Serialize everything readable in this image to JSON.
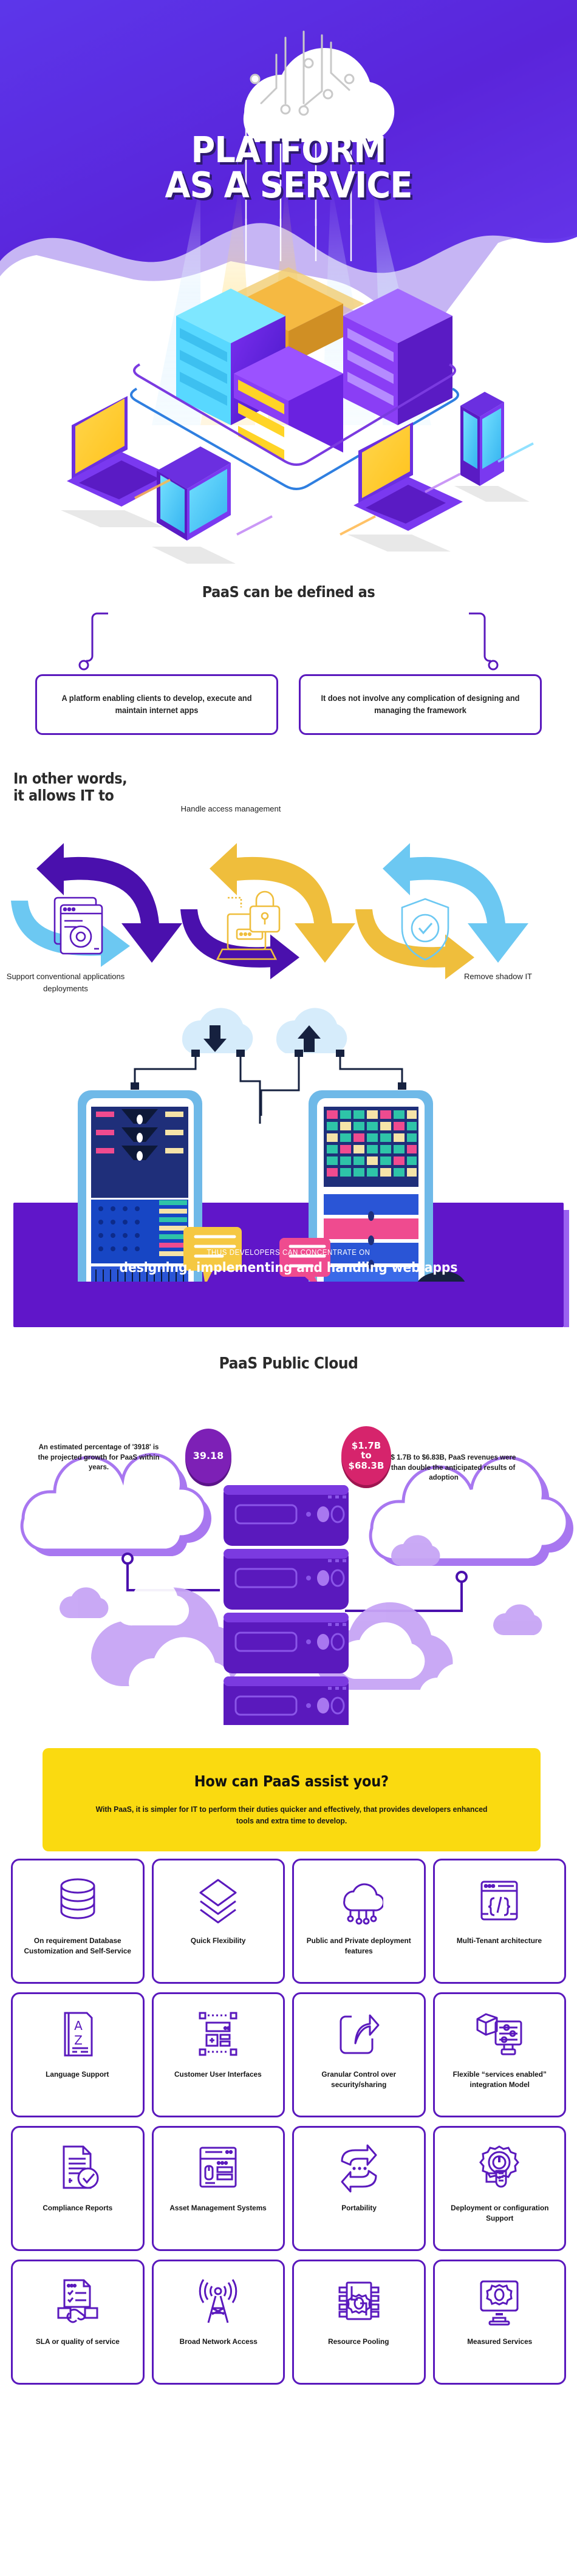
{
  "hero": {
    "title_line1": "PLATFORM",
    "title_line2": "AS A SERVICE",
    "cloud_icon": "cloud-circuit-icon",
    "devices": [
      "laptop",
      "tablet",
      "laptop",
      "smartphone"
    ]
  },
  "defined": {
    "heading": "PaaS can be defined as",
    "boxes": [
      {
        "text": "A platform enabling clients to develop, execute and maintain internet apps"
      },
      {
        "text": "It does not involve any complication of designing and managing the framework"
      }
    ]
  },
  "in_other_words": {
    "heading_line1": "In other words,",
    "heading_line2": "it allows IT to",
    "items": [
      {
        "label": "Support conventional applications deployments",
        "icon": "window-gear-icon",
        "color": "#5a19bd"
      },
      {
        "label": "Handle access management",
        "icon": "laptop-lock-icon",
        "color": "#efbe3c"
      },
      {
        "label": "Remove shadow IT",
        "icon": "shield-check-icon",
        "color": "#6cc8f2"
      }
    ],
    "arrow_colors": [
      "#4a10ad",
      "#6cc8f2",
      "#efbe3c"
    ]
  },
  "banner": {
    "small_text": "THUS DEVELOPERS CAN CONCENTRATE ON",
    "large_text": "designing, implementing and handling web apps",
    "background_color": "#6016c9"
  },
  "public_cloud": {
    "heading": "PaaS Public Cloud",
    "left_bubble": "39.18",
    "left_bubble_color": "#7d20b6",
    "left_cloud_text": "An estimated percentage of '3918' is the projected growth for PaaS within years.",
    "right_bubble_line1": "$1.7B",
    "right_bubble_line2": "to",
    "right_bubble_line3": "$68.3B",
    "right_bubble_color": "#d6246c",
    "right_cloud_text": "From $ 1.7B to $6.83B, PaaS revenues were more than double the anticipated results of adoption"
  },
  "assist": {
    "title": "How can PaaS assist you?",
    "subtitle": "With PaaS, it is simpler for IT to perform their duties quicker and effectively, that provides developers enhanced tools and extra time to develop.",
    "background_color": "#fada10"
  },
  "features": [
    {
      "label": "On requirement Database Customization and Self-Service",
      "icon": "database-icon"
    },
    {
      "label": "Quick Flexibility",
      "icon": "layers-icon"
    },
    {
      "label": "Public and Private deployment features",
      "icon": "cloud-network-icon"
    },
    {
      "label": "Multi-Tenant architecture",
      "icon": "code-window-icon"
    },
    {
      "label": "Language Support",
      "icon": "book-az-icon"
    },
    {
      "label": "Customer User Interfaces",
      "icon": "wireframe-icon"
    },
    {
      "label": "Granular Control over security/sharing",
      "icon": "share-arrow-icon"
    },
    {
      "label": "Flexible “services enabled” integration Model",
      "icon": "box-monitor-sliders-icon"
    },
    {
      "label": "Compliance Reports",
      "icon": "document-check-icon"
    },
    {
      "label": "Asset Management Systems",
      "icon": "asset-dashboard-icon"
    },
    {
      "label": "Portability",
      "icon": "two-way-arrows-icon"
    },
    {
      "label": "Deployment or configuration Support",
      "icon": "gear-wrench-icon"
    },
    {
      "label": "SLA or quality of service",
      "icon": "handshake-document-icon"
    },
    {
      "label": "Broad Network Access",
      "icon": "antenna-tower-icon"
    },
    {
      "label": "Resource Pooling",
      "icon": "chip-gear-icon"
    },
    {
      "label": "Measured Services",
      "icon": "monitor-gear-icon"
    }
  ],
  "colors": {
    "primary_purple": "#5a19bd",
    "deep_purple": "#4a10ad",
    "hero_purple": "#5b3bea",
    "yellow": "#fada10",
    "sky_blue": "#6cc8f2",
    "pink": "#d6246c"
  }
}
